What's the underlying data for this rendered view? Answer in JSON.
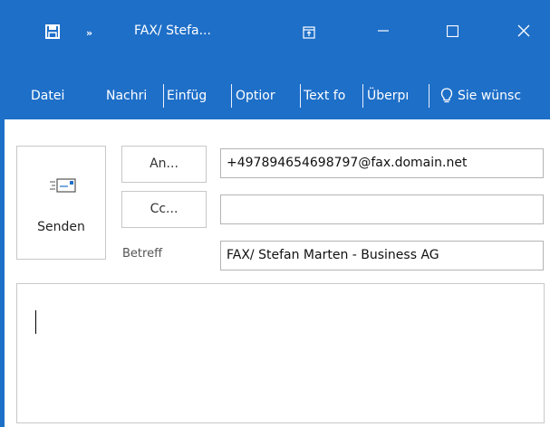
{
  "window": {
    "title": "FAX/ Stefa...",
    "qat_more": "»",
    "icons": [
      "save-icon",
      "ribbon-display-options-icon",
      "minimize-icon",
      "maximize-icon",
      "close-icon"
    ]
  },
  "ribbon": {
    "tabs": [
      {
        "id": "datei",
        "label": "Datei"
      },
      {
        "id": "nachricht",
        "label": "Nachri"
      },
      {
        "id": "einfuegen",
        "label": "Einfüg"
      },
      {
        "id": "optionen",
        "label": "Optior"
      },
      {
        "id": "textformat",
        "label": "Text fo"
      },
      {
        "id": "ueberpruefen",
        "label": "Überpı"
      }
    ],
    "tell_me": "Sie wünsc"
  },
  "compose": {
    "send_label": "Senden",
    "to_button": "An...",
    "cc_button": "Cc...",
    "subject_label": "Betreff",
    "to_value": "+497894654698797@fax.domain.net",
    "cc_value": "",
    "subject_value": "FAX/ Stefan Marten - Business AG",
    "body_value": ""
  },
  "colors": {
    "accent": "#1e6fc8",
    "border": "#c8c8c8"
  }
}
